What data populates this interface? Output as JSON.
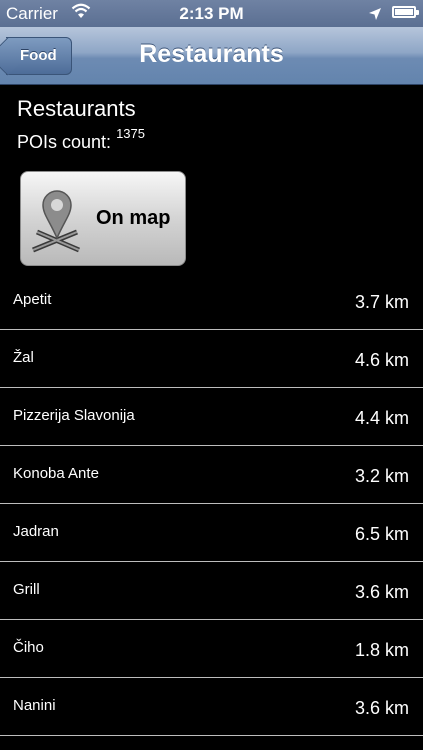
{
  "status_bar": {
    "carrier": "Carrier",
    "time": "2:13 PM"
  },
  "nav": {
    "back_label": "Food",
    "title": "Restaurants"
  },
  "header": {
    "title": "Restaurants",
    "poi_label": "POIs count:",
    "poi_count": "1375"
  },
  "map_button": {
    "label": "On map"
  },
  "list": [
    {
      "name": "Apetit",
      "distance": "3.7 km"
    },
    {
      "name": "Žal",
      "distance": "4.6 km"
    },
    {
      "name": "Pizzerija Slavonija",
      "distance": "4.4 km"
    },
    {
      "name": "Konoba Ante",
      "distance": "3.2 km"
    },
    {
      "name": "Jadran",
      "distance": "6.5 km"
    },
    {
      "name": "Grill",
      "distance": "3.6 km"
    },
    {
      "name": "Čiho",
      "distance": "1.8 km"
    },
    {
      "name": "Nanini",
      "distance": "3.6 km"
    }
  ]
}
